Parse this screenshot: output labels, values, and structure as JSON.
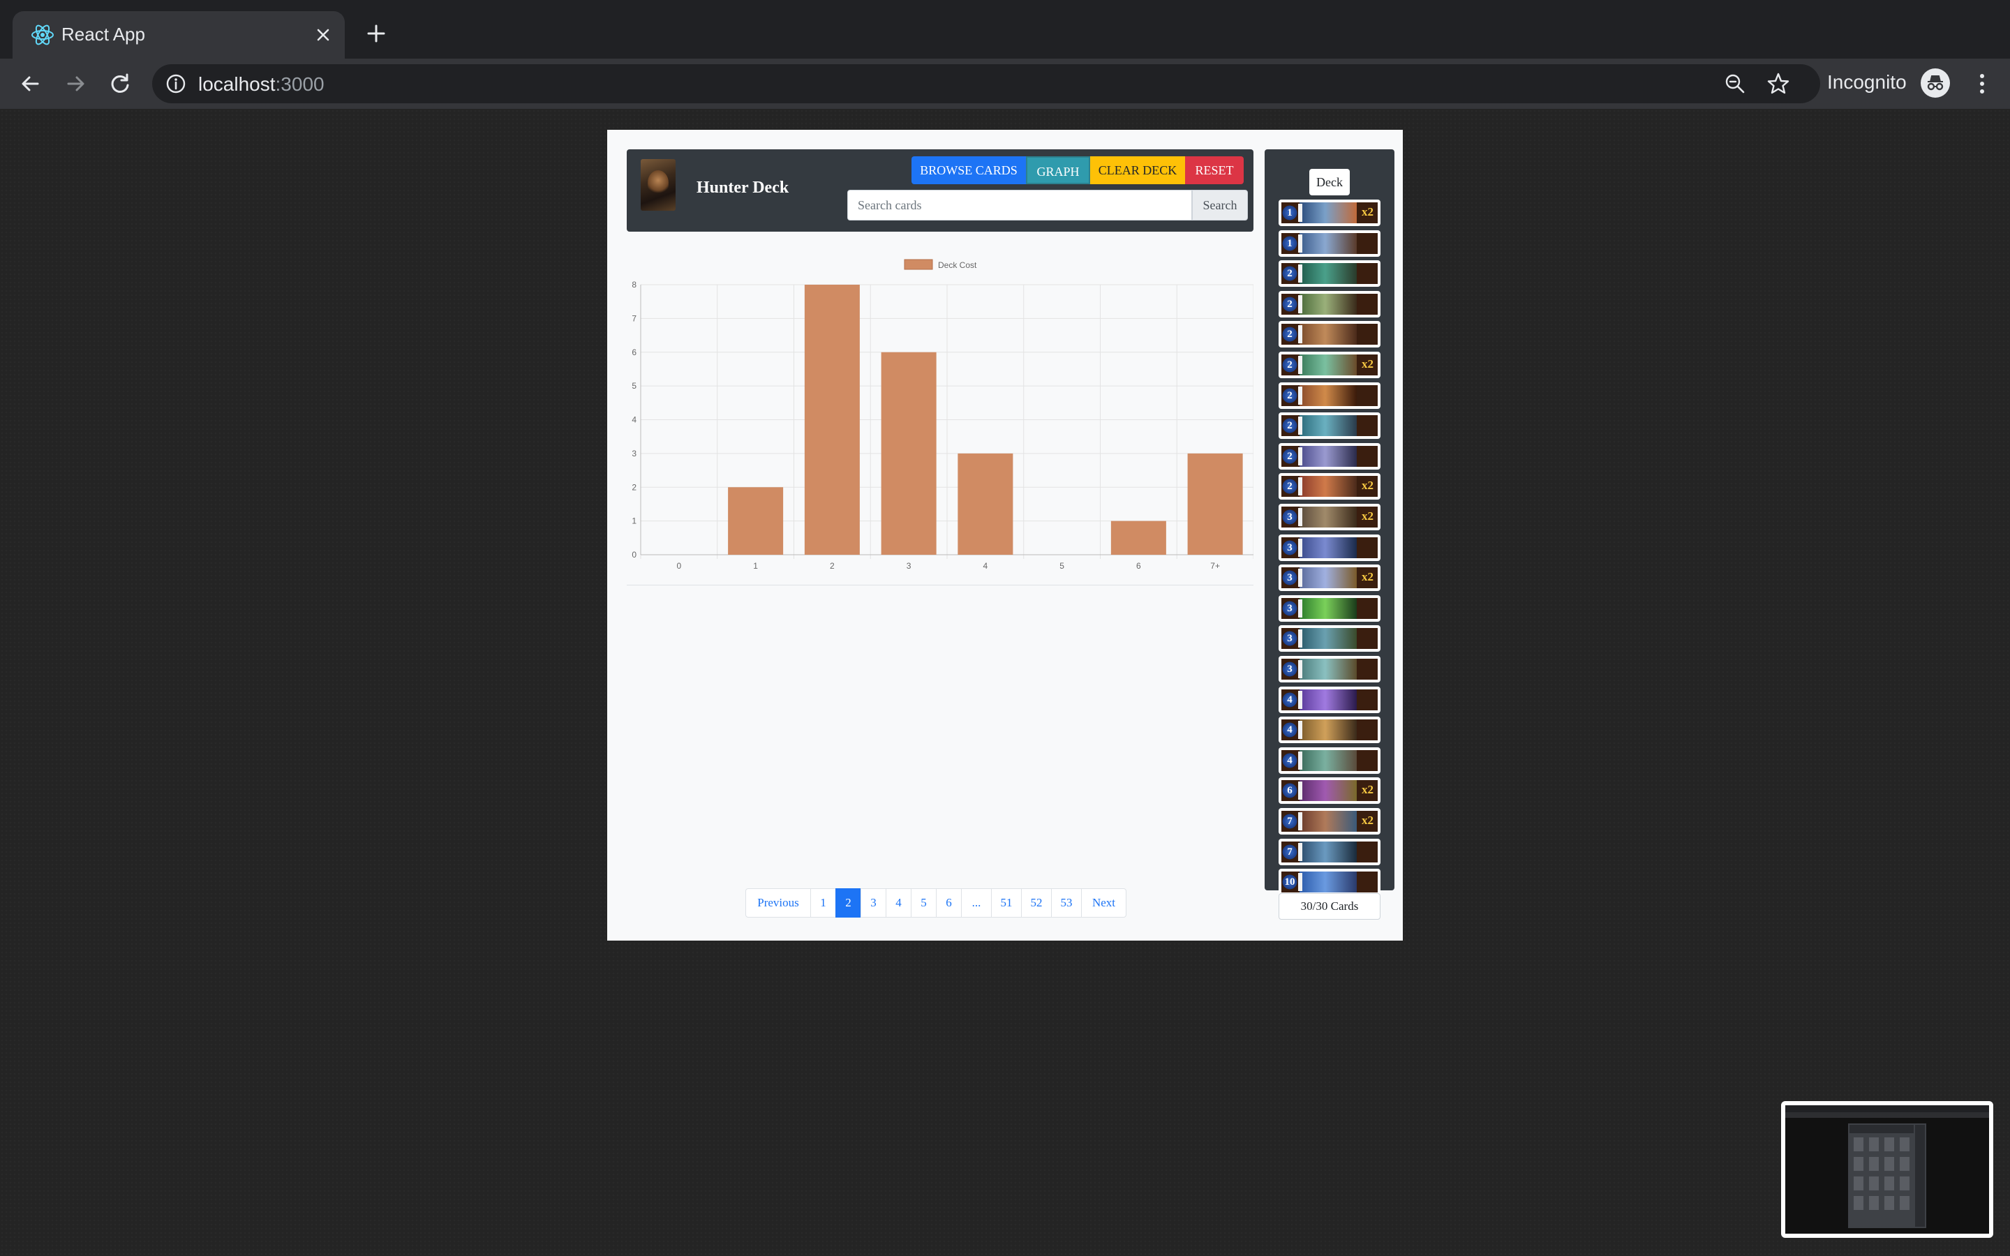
{
  "browser": {
    "tab_title": "React App",
    "url_host": "localhost",
    "url_port": ":3000",
    "profile_label": "Incognito",
    "icons": {
      "favicon": "react-icon",
      "tab_close": "close-icon",
      "new_tab": "plus-icon",
      "back": "arrow-left-icon",
      "forward": "arrow-right-icon",
      "reload": "reload-icon",
      "site_info": "info-icon",
      "zoom": "zoom-out-icon",
      "bookmark": "star-icon",
      "incognito": "incognito-icon",
      "menu": "more-vert-icon"
    }
  },
  "header": {
    "deck_title": "Hunter Deck",
    "buttons": {
      "browse": "BROWSE CARDS",
      "graph": "GRAPH",
      "clear": "CLEAR DECK",
      "reset": "RESET"
    },
    "search": {
      "placeholder": "Search cards",
      "button": "Search"
    }
  },
  "colors": {
    "primary": "#1d74f5",
    "info": "#2f9bad",
    "warning": "#fec107",
    "danger": "#dc3545",
    "bar": "#d08b63",
    "dark_panel": "#343a40"
  },
  "chart_data": {
    "type": "bar",
    "legend": "Deck Cost",
    "categories": [
      "0",
      "1",
      "2",
      "3",
      "4",
      "5",
      "6",
      "7+"
    ],
    "values": [
      0,
      2,
      8,
      6,
      3,
      0,
      1,
      3
    ],
    "yticks": [
      "0",
      "1",
      "2",
      "3",
      "4",
      "5",
      "6",
      "7",
      "8"
    ],
    "ylim": [
      0,
      8
    ],
    "grid": true,
    "legend_position": "top-center"
  },
  "pagination": {
    "items": [
      "Previous",
      "1",
      "2",
      "3",
      "4",
      "5",
      "6",
      "...",
      "51",
      "52",
      "53",
      "Next"
    ],
    "active": "2"
  },
  "deck": {
    "badge": "Deck",
    "count_label": "30/30 Cards",
    "cards": [
      {
        "mana": "1",
        "copies": "x2"
      },
      {
        "mana": "1",
        "copies": ""
      },
      {
        "mana": "2",
        "copies": ""
      },
      {
        "mana": "2",
        "copies": ""
      },
      {
        "mana": "2",
        "copies": ""
      },
      {
        "mana": "2",
        "copies": "x2"
      },
      {
        "mana": "2",
        "copies": ""
      },
      {
        "mana": "2",
        "copies": ""
      },
      {
        "mana": "2",
        "copies": ""
      },
      {
        "mana": "2",
        "copies": "x2"
      },
      {
        "mana": "3",
        "copies": "x2"
      },
      {
        "mana": "3",
        "copies": ""
      },
      {
        "mana": "3",
        "copies": "x2"
      },
      {
        "mana": "3",
        "copies": ""
      },
      {
        "mana": "3",
        "copies": ""
      },
      {
        "mana": "3",
        "copies": ""
      },
      {
        "mana": "4",
        "copies": ""
      },
      {
        "mana": "4",
        "copies": ""
      },
      {
        "mana": "4",
        "copies": ""
      },
      {
        "mana": "6",
        "copies": "x2"
      },
      {
        "mana": "7",
        "copies": "x2"
      },
      {
        "mana": "7",
        "copies": ""
      },
      {
        "mana": "10",
        "copies": ""
      }
    ]
  }
}
